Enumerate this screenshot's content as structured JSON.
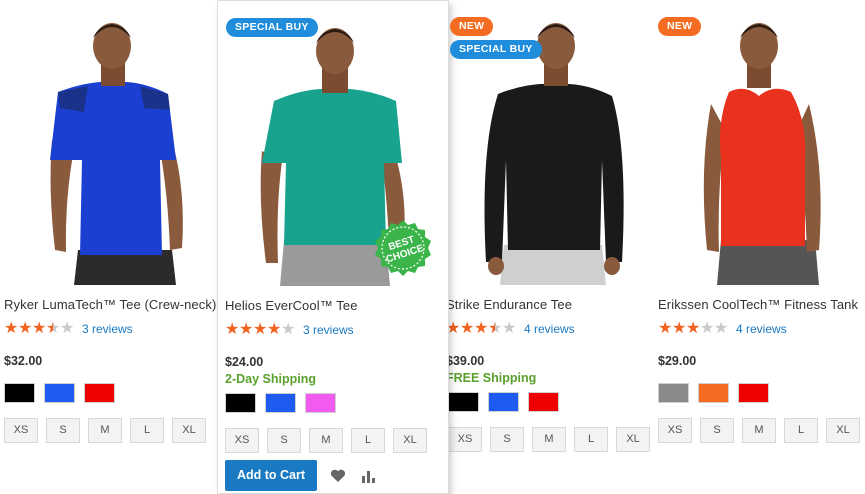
{
  "products": [
    {
      "name": "Ryker LumaTech™ Tee (Crew-neck)",
      "rating_stars": 3.5,
      "reviews": "3 reviews",
      "price": "$32.00",
      "swatches": [
        "#000000",
        "#1e5bf0",
        "#f00000"
      ],
      "sizes": [
        "XS",
        "S",
        "M",
        "L",
        "XL"
      ],
      "shirt_color": "#1b3fd1"
    },
    {
      "name": "Helios EverCool™ Tee",
      "badges": [
        "SPECIAL BUY"
      ],
      "seal": [
        "BEST",
        "CHOICE"
      ],
      "rating_stars": 4,
      "reviews": "3 reviews",
      "price": "$24.00",
      "shipping": "2-Day Shipping",
      "swatches": [
        "#000000",
        "#1e5bf0",
        "#f25bf0"
      ],
      "sizes": [
        "XS",
        "S",
        "M",
        "L",
        "XL"
      ],
      "cart_label": "Add to Cart",
      "wishlist_icon": "heart-icon",
      "compare_icon": "compare-icon",
      "shirt_color": "#17a38d"
    },
    {
      "name": "Strike Endurance Tee",
      "badges": [
        "NEW",
        "SPECIAL BUY"
      ],
      "rating_stars": 3.5,
      "reviews": "4 reviews",
      "price": "$39.00",
      "shipping": "FREE Shipping",
      "swatches": [
        "#000000",
        "#1e5bf0",
        "#f00000"
      ],
      "sizes": [
        "XS",
        "S",
        "M",
        "L",
        "XL"
      ],
      "shirt_color": "#1a1a1a"
    },
    {
      "name": "Erikssen CoolTech™ Fitness Tank",
      "badges": [
        "NEW"
      ],
      "rating_stars": 3,
      "reviews": "4 reviews",
      "price": "$29.00",
      "swatches": [
        "#8a8a8a",
        "#f36c21",
        "#f00000"
      ],
      "sizes": [
        "XS",
        "S",
        "M",
        "L",
        "XL"
      ],
      "shirt_color": "#e8321e"
    }
  ],
  "colors": {
    "star_on": "#f26322",
    "star_off": "#c9c9c9",
    "accent": "#1979c3",
    "shipping": "#5aa02c"
  }
}
